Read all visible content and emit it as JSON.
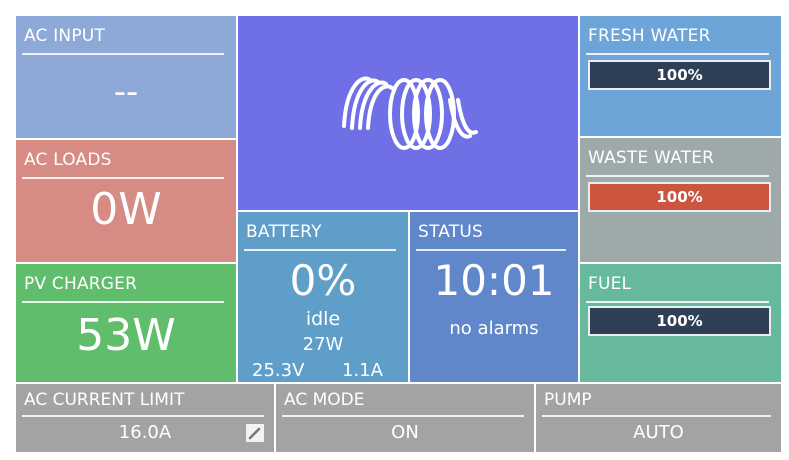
{
  "colors": {
    "ac_input": "#8ea9d7",
    "ac_loads": "#d78b85",
    "pv_charger": "#5fbd6b",
    "logo_tile": "#7070e6",
    "battery": "#5e9ec9",
    "status": "#5f87c9",
    "fresh_water": "#6ea5d9",
    "waste_water": "#9ea9a9",
    "fuel": "#66b99c",
    "footer": "#a3a3a3",
    "level_dark": "#2f3f56",
    "level_red": "#cc5540"
  },
  "ac_input": {
    "title": "AC INPUT",
    "value": "--"
  },
  "ac_loads": {
    "title": "AC LOADS",
    "value": "0W"
  },
  "pv_charger": {
    "title": "PV CHARGER",
    "value": "53W"
  },
  "logo": {
    "icon": "victron-logo-icon"
  },
  "battery": {
    "title": "BATTERY",
    "percent": "0%",
    "state": "idle",
    "power": "27W",
    "voltage": "25.3V",
    "current": "1.1A"
  },
  "status": {
    "title": "STATUS",
    "time": "10:01",
    "alarms": "no alarms"
  },
  "fresh_water": {
    "title": "FRESH WATER",
    "level": "100%",
    "level_fraction": 1.0
  },
  "waste_water": {
    "title": "WASTE WATER",
    "level": "100%",
    "level_fraction": 1.0
  },
  "fuel": {
    "title": "FUEL",
    "level": "100%",
    "level_fraction": 1.0
  },
  "footer": {
    "ac_current_limit": {
      "title": "AC CURRENT LIMIT",
      "value": "16.0A",
      "icon": "edit-icon"
    },
    "ac_mode": {
      "title": "AC MODE",
      "value": "ON"
    },
    "pump": {
      "title": "PUMP",
      "value": "AUTO"
    }
  }
}
